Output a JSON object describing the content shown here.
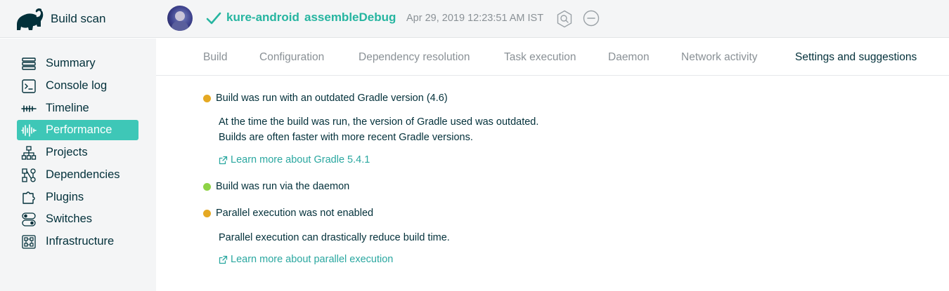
{
  "header": {
    "app_title": "Build scan",
    "project": "kure-android",
    "task": "assembleDebug",
    "timestamp": "Apr 29, 2019 12:23:51 AM IST",
    "status": "success",
    "icons": [
      "gradle-elephant-icon",
      "avatar",
      "check-icon",
      "search-hex-icon",
      "minus-circle-icon"
    ]
  },
  "sidebar": {
    "items": [
      {
        "label": "Summary",
        "icon": "summary-icon"
      },
      {
        "label": "Console log",
        "icon": "console-icon"
      },
      {
        "label": "Timeline",
        "icon": "timeline-icon"
      },
      {
        "label": "Performance",
        "icon": "performance-icon",
        "active": true
      },
      {
        "label": "Projects",
        "icon": "projects-icon"
      },
      {
        "label": "Dependencies",
        "icon": "dependencies-icon"
      },
      {
        "label": "Plugins",
        "icon": "plugins-icon"
      },
      {
        "label": "Switches",
        "icon": "switches-icon"
      },
      {
        "label": "Infrastructure",
        "icon": "infrastructure-icon"
      }
    ]
  },
  "tabs": [
    {
      "label": "Build"
    },
    {
      "label": "Configuration"
    },
    {
      "label": "Dependency resolution"
    },
    {
      "label": "Task execution"
    },
    {
      "label": "Daemon"
    },
    {
      "label": "Network activity"
    },
    {
      "label": "Settings and suggestions",
      "active": true
    }
  ],
  "suggestions": [
    {
      "title": "Build was run with an outdated Gradle version (4.6)",
      "status_color": "#e5a923",
      "lines": [
        "At the time the build was run, the version of Gradle used was outdated.",
        "Builds are often faster with more recent Gradle versions."
      ],
      "link": "Learn more about Gradle 5.4.1"
    },
    {
      "title": "Build was run via the daemon",
      "status_color": "#8ed346"
    },
    {
      "title": "Parallel execution was not enabled",
      "status_color": "#e5a923",
      "lines": [
        "Parallel execution can drastically reduce build time."
      ],
      "link": "Learn more about parallel execution"
    }
  ],
  "colors": {
    "accent": "#3ec7b7",
    "success": "#26b5a0",
    "link": "#2aa7a0",
    "warning": "#e5a923",
    "ok": "#8ed346"
  }
}
